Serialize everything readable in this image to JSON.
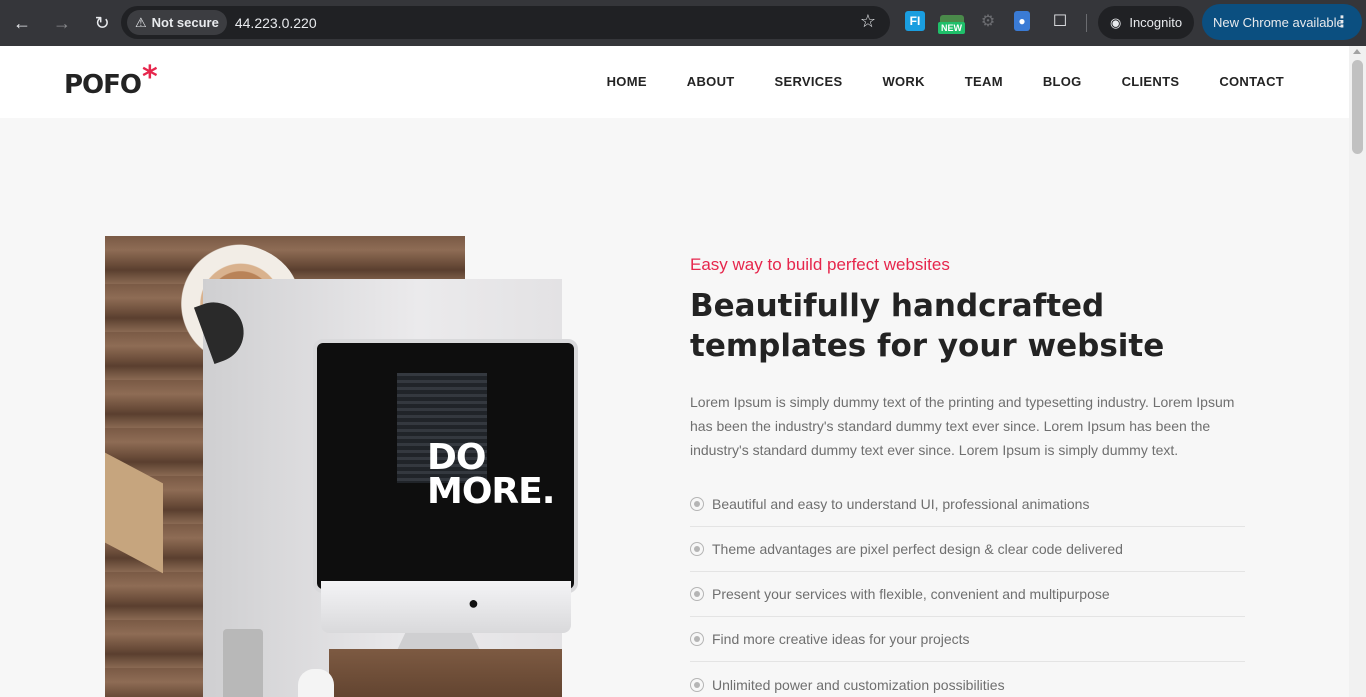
{
  "browser": {
    "security_label": "Not secure",
    "url": "44.223.0.220",
    "ext_fi": "FI",
    "ext_new_badge": "NEW",
    "incognito_label": "Incognito",
    "update_label": "New Chrome available"
  },
  "site": {
    "logo": "POFO",
    "logo_mark": "*",
    "menu": [
      "HOME",
      "ABOUT",
      "SERVICES",
      "WORK",
      "TEAM",
      "BLOG",
      "CLIENTS",
      "CONTACT"
    ]
  },
  "hero": {
    "image_text_line1": "DO",
    "image_text_line2": "MORE.",
    "tagline": "Easy way to build perfect websites",
    "heading": "Beautifully handcrafted templates for your website",
    "paragraph": "Lorem Ipsum is simply dummy text of the printing and typesetting industry. Lorem Ipsum has been the industry's standard dummy text ever since. Lorem Ipsum has been the industry's standard dummy text ever since. Lorem Ipsum is simply dummy text.",
    "features": [
      "Beautiful and easy to understand UI, professional animations",
      "Theme advantages are pixel perfect design & clear code delivered",
      "Present your services with flexible, convenient and multipurpose",
      "Find more creative ideas for your projects",
      "Unlimited power and customization possibilities"
    ]
  },
  "colors": {
    "accent": "#e6264c",
    "text_dark": "#232323",
    "text_muted": "#6f6f6f"
  }
}
